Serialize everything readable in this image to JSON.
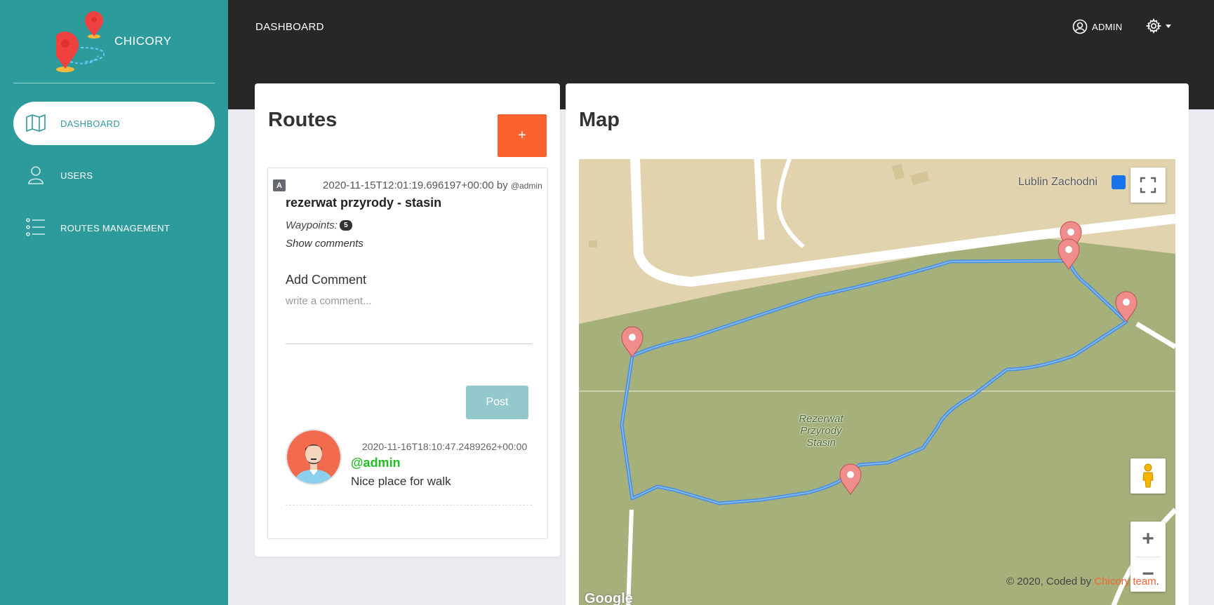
{
  "brand": {
    "name": "CHICORY"
  },
  "sidebar": {
    "items": [
      {
        "label": "DASHBOARD",
        "icon": "map-icon",
        "active": true
      },
      {
        "label": "USERS",
        "icon": "user-icon",
        "active": false
      },
      {
        "label": "ROUTES MANAGEMENT",
        "icon": "list-icon",
        "active": false
      }
    ]
  },
  "header": {
    "title": "DASHBOARD",
    "user_label": "ADMIN",
    "settings_icon": "gear-icon"
  },
  "routes": {
    "title": "Routes",
    "add_label": "+",
    "add_color": "#fa6230",
    "item": {
      "badge": "A",
      "timestamp": "2020-11-15T12:01:19.696197+00:00",
      "by_label": "by",
      "author": "@admin",
      "name": "rezerwat przyrody - stasin",
      "waypoints_label": "Waypoints:",
      "waypoints_count": "5",
      "show_comments": "Show comments",
      "add_comment_label": "Add Comment",
      "comment_placeholder": "write a comment...",
      "post_label": "Post",
      "comments": [
        {
          "timestamp": "2020-11-16T18:10:47.2489262+00:00",
          "user": "@admin",
          "text": "Nice place for walk"
        }
      ]
    }
  },
  "map": {
    "title": "Map",
    "station_label": "Lublin Zachodni",
    "park_label": "Rezerwat Przyrody Stasin",
    "google_label": "Google",
    "zoom_in": "+",
    "zoom_out": "−"
  },
  "footer": {
    "prefix": "© 2020, Coded by",
    "team": "Chicory team",
    "suffix": "."
  },
  "colors": {
    "sidebar": "#2d9a9c",
    "header": "#272727",
    "accent": "#fa6230",
    "route_line": "#4a90e2"
  }
}
